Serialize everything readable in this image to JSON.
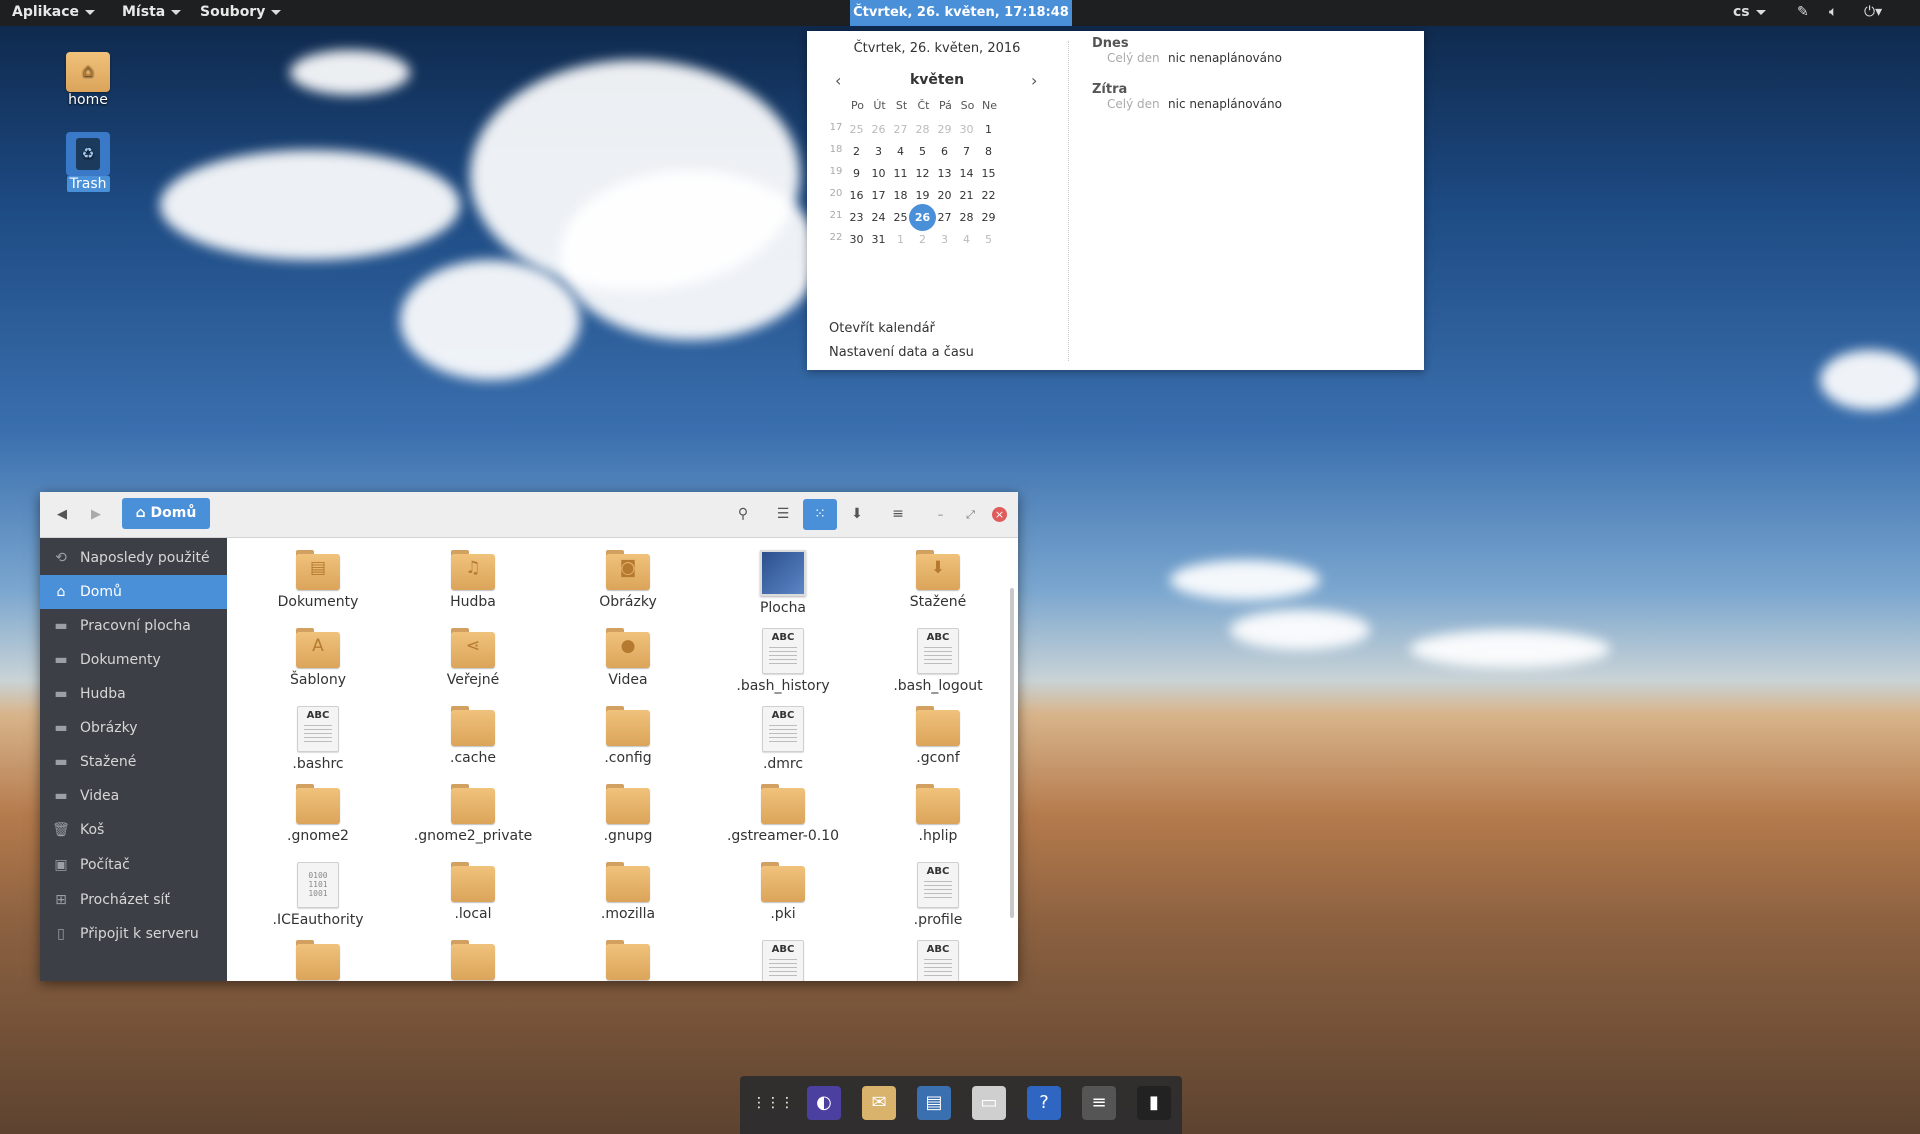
{
  "topbar": {
    "menus": [
      "Aplikace",
      "Místa",
      "Soubory"
    ],
    "clock": "Čtvrtek, 26. květen, 17:18:48",
    "keyboard": "cs"
  },
  "desktop": {
    "icons": [
      {
        "label": "home",
        "icon": "home-folder-icon"
      },
      {
        "label": "Trash",
        "icon": "trash-icon"
      }
    ]
  },
  "calendar": {
    "date_title": "Čtvrtek, 26. květen, 2016",
    "month": "květen",
    "weekdays": [
      "Po",
      "Út",
      "St",
      "Čt",
      "Pá",
      "So",
      "Ne"
    ],
    "weeks": [
      {
        "num": "17",
        "days": [
          "25",
          "26",
          "27",
          "28",
          "29",
          "30",
          "1"
        ]
      },
      {
        "num": "18",
        "days": [
          "2",
          "3",
          "4",
          "5",
          "6",
          "7",
          "8"
        ]
      },
      {
        "num": "19",
        "days": [
          "9",
          "10",
          "11",
          "12",
          "13",
          "14",
          "15"
        ]
      },
      {
        "num": "20",
        "days": [
          "16",
          "17",
          "18",
          "19",
          "20",
          "21",
          "22"
        ]
      },
      {
        "num": "21",
        "days": [
          "23",
          "24",
          "25",
          "26",
          "27",
          "28",
          "29"
        ]
      },
      {
        "num": "22",
        "days": [
          "30",
          "31",
          "1",
          "2",
          "3",
          "4",
          "5"
        ]
      }
    ],
    "today": "26",
    "links": [
      "Otevřít kalendář",
      "Nastavení data a času"
    ],
    "events": [
      {
        "heading": "Dnes",
        "time": "Celý den",
        "text": "nic nenaplánováno"
      },
      {
        "heading": "Zítra",
        "time": "Celý den",
        "text": "nic nenaplánováno"
      }
    ]
  },
  "file_manager": {
    "breadcrumb": "Domů",
    "sidebar": [
      {
        "label": "Naposledy použité",
        "icon": "recent-icon"
      },
      {
        "label": "Domů",
        "icon": "home-icon",
        "active": true
      },
      {
        "label": "Pracovní plocha",
        "icon": "folder-icon"
      },
      {
        "label": "Dokumenty",
        "icon": "folder-icon"
      },
      {
        "label": "Hudba",
        "icon": "folder-icon"
      },
      {
        "label": "Obrázky",
        "icon": "folder-icon"
      },
      {
        "label": "Stažené",
        "icon": "folder-icon"
      },
      {
        "label": "Videa",
        "icon": "folder-icon"
      },
      {
        "label": "Koš",
        "icon": "trash-icon"
      },
      {
        "label": "Počítač",
        "icon": "computer-icon"
      },
      {
        "label": "Procházet síť",
        "icon": "network-icon"
      },
      {
        "label": "Připojit k serveru",
        "icon": "server-icon"
      }
    ],
    "files": [
      {
        "name": "Dokumenty",
        "type": "folder",
        "glyph": "▤"
      },
      {
        "name": "Hudba",
        "type": "folder",
        "glyph": "♫"
      },
      {
        "name": "Obrázky",
        "type": "folder",
        "glyph": "◙"
      },
      {
        "name": "Plocha",
        "type": "desktop"
      },
      {
        "name": "Stažené",
        "type": "folder",
        "glyph": "⬇"
      },
      {
        "name": "Šablony",
        "type": "folder",
        "glyph": "A"
      },
      {
        "name": "Veřejné",
        "type": "folder",
        "glyph": "⋖"
      },
      {
        "name": "Videa",
        "type": "folder",
        "glyph": "●"
      },
      {
        "name": ".bash_history",
        "type": "text"
      },
      {
        "name": ".bash_logout",
        "type": "text"
      },
      {
        "name": ".bashrc",
        "type": "text"
      },
      {
        "name": ".cache",
        "type": "folder"
      },
      {
        "name": ".config",
        "type": "folder"
      },
      {
        "name": ".dmrc",
        "type": "text"
      },
      {
        "name": ".gconf",
        "type": "folder"
      },
      {
        "name": ".gnome2",
        "type": "folder"
      },
      {
        "name": ".gnome2_private",
        "type": "folder"
      },
      {
        "name": ".gnupg",
        "type": "folder"
      },
      {
        "name": ".gstreamer-0.10",
        "type": "folder"
      },
      {
        "name": ".hplip",
        "type": "folder"
      },
      {
        "name": ".ICEauthority",
        "type": "binary"
      },
      {
        "name": ".local",
        "type": "folder"
      },
      {
        "name": ".mozilla",
        "type": "folder"
      },
      {
        "name": ".pki",
        "type": "folder"
      },
      {
        "name": ".profile",
        "type": "text"
      },
      {
        "name": "",
        "type": "folder"
      },
      {
        "name": "",
        "type": "folder"
      },
      {
        "name": "",
        "type": "folder"
      },
      {
        "name": "",
        "type": "text"
      },
      {
        "name": "",
        "type": "text"
      }
    ],
    "text_icon_label": "ABC",
    "binary_icon_text": "0100\n1101\n1001"
  },
  "dock": [
    {
      "name": "app-grid-icon",
      "glyph": "⋮⋮⋮"
    },
    {
      "name": "web-browser-icon",
      "glyph": "◐"
    },
    {
      "name": "mail-icon",
      "glyph": "✉"
    },
    {
      "name": "text-editor-icon",
      "glyph": "▤"
    },
    {
      "name": "files-icon",
      "glyph": "▭"
    },
    {
      "name": "help-icon",
      "glyph": "?"
    },
    {
      "name": "settings-icon",
      "glyph": "≡"
    },
    {
      "name": "terminal-icon",
      "glyph": "▮"
    }
  ],
  "colors": {
    "accent": "#4a90d9",
    "sidebar": "#3c3f45",
    "topbar": "#1d1f21",
    "folder": "#e8b56a"
  }
}
